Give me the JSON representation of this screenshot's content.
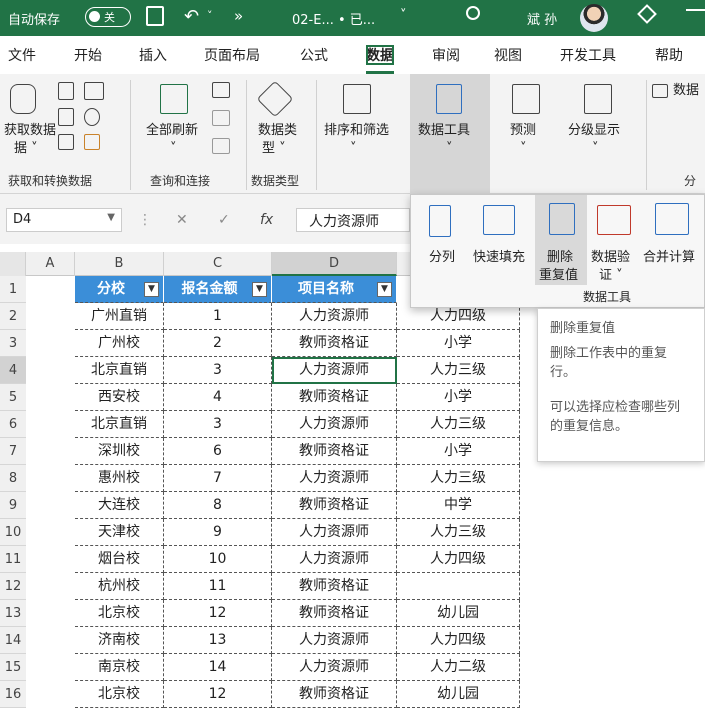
{
  "titlebar": {
    "autosave": "自动保存",
    "toggle_state": "关",
    "save_icon": "floppy-icon",
    "undo_icon": "undo-icon",
    "more": "»",
    "doc_name": "02-E... • 已...",
    "user": "斌 孙",
    "accent": "#217346"
  },
  "tabs": [
    "文件",
    "开始",
    "插入",
    "页面布局",
    "公式",
    "数据",
    "审阅",
    "视图",
    "开发工具",
    "帮助"
  ],
  "ribbon": {
    "get_data": "获取数据",
    "get_data2": "据 ˅",
    "refresh_all": "全部刷新",
    "data_type": "数据类",
    "data_type2": "型 ˅",
    "sort_filter": "排序和筛选",
    "data_tools": "数据工具",
    "forecast": "预测",
    "outline": "分级显示",
    "data_right": "数据",
    "groups": {
      "g1": "获取和转换数据",
      "g2": "查询和连接",
      "g3": "数据类型",
      "g4": "分"
    }
  },
  "formula_bar": {
    "name_box": "D4",
    "cancel": "✕",
    "enter": "✓",
    "fx": "fx",
    "value": "人力资源师"
  },
  "dropdown": {
    "items": [
      "分列",
      "快速填充",
      "删除",
      "重复值",
      "数据验",
      "证 ˅",
      "合并计算"
    ],
    "group_label": "数据工具"
  },
  "tooltip": {
    "title": "删除重复值",
    "line1": "删除工作表中的重复",
    "line2": "行。",
    "line3": "可以选择应检查哪些列",
    "line4": "的重复信息。"
  },
  "columns": [
    "A",
    "B",
    "C",
    "D",
    "E"
  ],
  "table": {
    "headers": [
      "分校",
      "报名金额",
      "项目名称"
    ],
    "rows": [
      [
        "广州直销",
        "1",
        "人力资源师",
        "人力四级"
      ],
      [
        "广州校",
        "2",
        "教师资格证",
        "小学"
      ],
      [
        "北京直销",
        "3",
        "人力资源师",
        "人力三级"
      ],
      [
        "西安校",
        "4",
        "教师资格证",
        "小学"
      ],
      [
        "北京直销",
        "3",
        "人力资源师",
        "人力三级"
      ],
      [
        "深圳校",
        "6",
        "教师资格证",
        "小学"
      ],
      [
        "惠州校",
        "7",
        "人力资源师",
        "人力三级"
      ],
      [
        "大连校",
        "8",
        "教师资格证",
        "中学"
      ],
      [
        "天津校",
        "9",
        "人力资源师",
        "人力三级"
      ],
      [
        "烟台校",
        "10",
        "人力资源师",
        "人力四级"
      ],
      [
        "杭州校",
        "11",
        "教师资格证",
        ""
      ],
      [
        "北京校",
        "12",
        "教师资格证",
        "幼儿园"
      ],
      [
        "济南校",
        "13",
        "人力资源师",
        "人力四级"
      ],
      [
        "南京校",
        "14",
        "人力资源师",
        "人力二级"
      ],
      [
        "北京校",
        "12",
        "教师资格证",
        "幼儿园"
      ]
    ]
  },
  "row_numbers": [
    "1",
    "2",
    "3",
    "4",
    "5",
    "6",
    "7",
    "8",
    "9",
    "10",
    "11",
    "12",
    "13",
    "14",
    "15",
    "16"
  ]
}
